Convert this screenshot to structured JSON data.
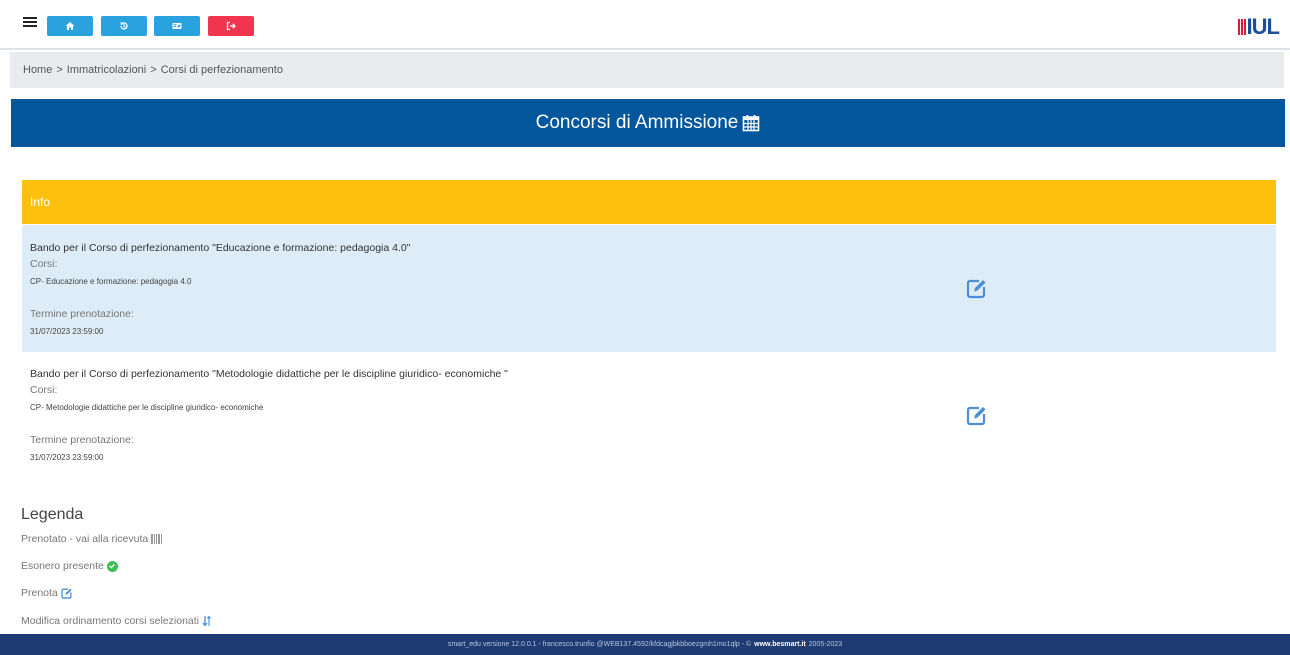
{
  "toolbar": {
    "buttons": [
      {
        "icon": "home-icon",
        "color": "#2aa2e0"
      },
      {
        "icon": "history-icon",
        "color": "#2aa2e0"
      },
      {
        "icon": "id-card-icon",
        "color": "#2aa2e0"
      },
      {
        "icon": "logout-icon",
        "color": "#f0364e"
      }
    ],
    "logo_text": "IUL"
  },
  "breadcrumb": {
    "home": "Home",
    "sep": ">",
    "level1": "Immatricolazioni",
    "level2": "Corsi di perfezionamento"
  },
  "page": {
    "title": "Concorsi di Ammissione",
    "title_bar_color": "#02569b"
  },
  "info": {
    "label": "Info",
    "color": "#fdc00d"
  },
  "items": [
    {
      "title": "Bando per il Corso di perfezionamento \"Educazione e formazione: pedagogia 4.0\"",
      "corsi_label": "Corsi:",
      "course": "CP- Educazione e formazione: pedagogia 4.0",
      "deadline_label": "Termine prenotazione:",
      "deadline": "31/07/2023 23:59:00"
    },
    {
      "title": "Bando per il Corso di perfezionamento \"Metodologie didattiche per le discipline giuridico- economiche \"",
      "corsi_label": "Corsi:",
      "course": "CP- Metodologie didattiche per le discipline giuridico- economiche",
      "deadline_label": "Termine prenotazione:",
      "deadline": "31/07/2023 23:59:00"
    }
  ],
  "legend": {
    "heading": "Legenda",
    "prenotato": "Prenotato - vai alla ricevuta",
    "esonero": "Esonero presente",
    "prenota": "Prenota",
    "modifica": "Modifica ordinamento corsi selezionati"
  },
  "footer": {
    "text": "smart_edu versione 12.0.0.1 - francesco.trunfio @WEB137.4592/kfdcagjbkbboezgmh1mo1qlp - ©",
    "brand": "www.besmart.it",
    "years": "2005-2023"
  }
}
